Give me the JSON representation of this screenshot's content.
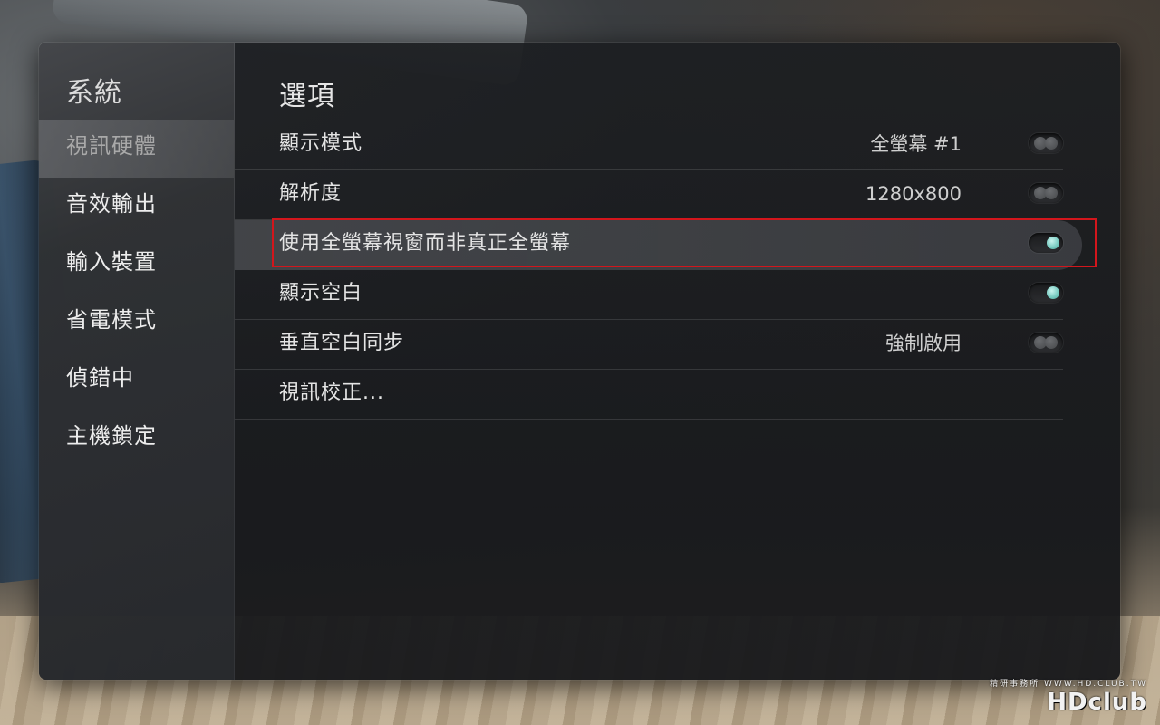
{
  "sidebar": {
    "title": "系統",
    "items": [
      {
        "label": "視訊硬體",
        "active": true
      },
      {
        "label": "音效輸出",
        "active": false
      },
      {
        "label": "輸入裝置",
        "active": false
      },
      {
        "label": "省電模式",
        "active": false
      },
      {
        "label": "偵錯中",
        "active": false
      },
      {
        "label": "主機鎖定",
        "active": false
      }
    ]
  },
  "main": {
    "title": "選項",
    "options": [
      {
        "label": "顯示模式",
        "value": "全螢幕 #1",
        "control": "spinner"
      },
      {
        "label": "解析度",
        "value": "1280x800",
        "control": "spinner"
      },
      {
        "label": "使用全螢幕視窗而非真正全螢幕",
        "value": "",
        "control": "toggle-on"
      },
      {
        "label": "顯示空白",
        "value": "",
        "control": "toggle-on"
      },
      {
        "label": "垂直空白同步",
        "value": "強制啟用",
        "control": "spinner"
      },
      {
        "label": "視訊校正...",
        "value": "",
        "control": "none"
      }
    ]
  },
  "colors": {
    "highlight_border": "#d3161c",
    "toggle_on": "#74c9bf"
  },
  "watermark": {
    "logo": "HDclub",
    "sub": "精研事務所 WWW.HD.CLUB.TW"
  }
}
